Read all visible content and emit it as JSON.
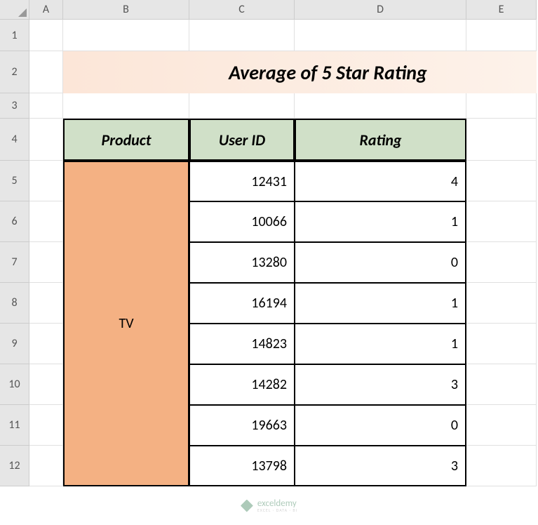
{
  "columns": [
    "A",
    "B",
    "C",
    "D",
    "E"
  ],
  "rows": [
    "1",
    "2",
    "3",
    "4",
    "5",
    "6",
    "7",
    "8",
    "9",
    "10",
    "11",
    "12"
  ],
  "title": "Average of 5 Star Rating",
  "headers": {
    "product": "Product",
    "userid": "User ID",
    "rating": "Rating"
  },
  "product": "TV",
  "data": [
    {
      "userid": "12431",
      "rating": "4"
    },
    {
      "userid": "10066",
      "rating": "1"
    },
    {
      "userid": "13280",
      "rating": "0"
    },
    {
      "userid": "16194",
      "rating": "1"
    },
    {
      "userid": "14823",
      "rating": "1"
    },
    {
      "userid": "14282",
      "rating": "3"
    },
    {
      "userid": "19663",
      "rating": "0"
    },
    {
      "userid": "13798",
      "rating": "3"
    }
  ],
  "watermark": {
    "name": "exceldemy",
    "tagline": "EXCEL · DATA · BI"
  }
}
